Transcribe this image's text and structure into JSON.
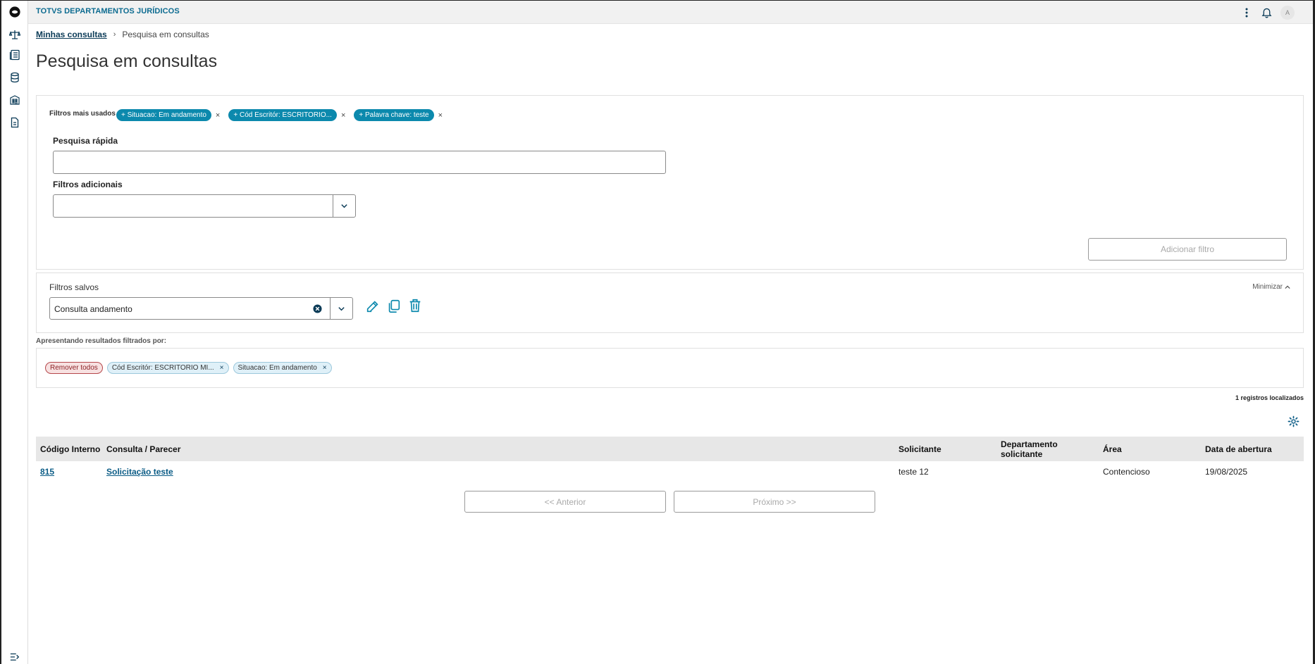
{
  "header": {
    "app_title": "TOTVS DEPARTAMENTOS JURÍDICOS",
    "avatar_initial": "A"
  },
  "sidebar": {
    "items": [
      {
        "icon": "scale-icon"
      },
      {
        "icon": "list-document-icon"
      },
      {
        "icon": "database-icon"
      },
      {
        "icon": "building-icon"
      },
      {
        "icon": "file-icon"
      }
    ]
  },
  "breadcrumb": {
    "parent": "Minhas consultas",
    "current": "Pesquisa em consultas"
  },
  "page": {
    "title": "Pesquisa em consultas"
  },
  "filters": {
    "most_used_label": "Filtros mais usados",
    "chips": [
      "+ Situacao: Em andamento",
      "+ Cód Escritór: ESCRITORIO...",
      "+ Palavra chave: teste"
    ],
    "chip_close": "×",
    "quick_search_label": "Pesquisa rápida",
    "quick_search_value": "",
    "additional_label": "Filtros adicionais",
    "additional_value": "",
    "add_button": "Adicionar filtro"
  },
  "saved_filters": {
    "title": "Filtros salvos",
    "minimize": "Minimizar",
    "selected": "Consulta andamento"
  },
  "applied": {
    "label": "Apresentando resultados filtrados por:",
    "remove_all": "Remover todos",
    "tags": [
      "Cód Escritór: ESCRITORIO MI...",
      "Situacao: Em andamento"
    ],
    "tag_close": "×"
  },
  "results": {
    "count": "1 registros localizados",
    "columns": [
      "Código Interno",
      "Consulta / Parecer",
      "Solicitante",
      "Departamento solicitante",
      "Área",
      "Data de abertura"
    ],
    "rows": [
      {
        "codigo": "815",
        "consulta": "Solicitação teste",
        "solicitante": "teste 12",
        "departamento": "",
        "area": "Contencioso",
        "data": "19/08/2025"
      }
    ]
  },
  "pagination": {
    "prev": "<< Anterior",
    "next": "Próximo >>"
  },
  "colors": {
    "accent": "#0c89ad",
    "title_blue": "#0c6b90",
    "link": "#0b5c86"
  }
}
